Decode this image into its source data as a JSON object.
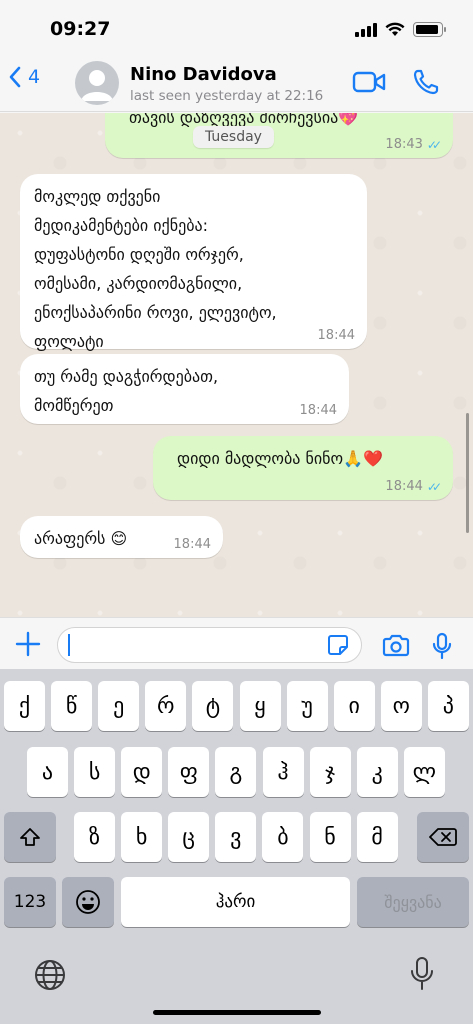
{
  "status_bar": {
    "time": "09:27",
    "battery_level": 0.9
  },
  "header": {
    "back_count": "4",
    "contact_name": "Nino Davidova",
    "last_seen": "last seen yesterday at 22:16"
  },
  "chat": {
    "partial_message": {
      "text": "თავის დაზღვევა ძირჩევსია",
      "emoji": "💖",
      "time": "18:43",
      "status": "read"
    },
    "date_separator": "Tuesday",
    "messages": [
      {
        "direction": "in",
        "text": "მოკლედ თქვენი\nმედიკამენტები იქნება:\nდუფასტონი დღეში ორჯერ,\nომესამი, კარდიომაგნილი,\nენოქსაპარინი როვი, ელევიტო,\nფოლატი",
        "time": "18:44"
      },
      {
        "direction": "in",
        "text": "თუ რამე დაგჭირდებათ,\nმომწერეთ",
        "time": "18:44"
      },
      {
        "direction": "out",
        "text": "დიდი მადლობა ნინო🙏❤️",
        "time": "18:44",
        "status": "read"
      },
      {
        "direction": "in",
        "text": "არაფერს 😊",
        "time": "18:44"
      }
    ]
  },
  "composer": {
    "value": "",
    "placeholder": ""
  },
  "keyboard": {
    "row1": [
      "ქ",
      "წ",
      "ე",
      "რ",
      "ტ",
      "ყ",
      "უ",
      "ი",
      "ო",
      "პ"
    ],
    "row2": [
      "ა",
      "ს",
      "დ",
      "ფ",
      "გ",
      "ჰ",
      "ჯ",
      "კ",
      "ლ"
    ],
    "row3": [
      "ზ",
      "ხ",
      "ც",
      "ვ",
      "ბ",
      "ნ",
      "მ"
    ],
    "numbers_label": "123",
    "space_label": "ჰარი",
    "return_label": "შეყვანა"
  },
  "colors": {
    "accent": "#1a7cf5",
    "outgoing_bubble": "#dcf8c6",
    "incoming_bubble": "#ffffff",
    "read_ticks": "#4fb6ec"
  }
}
